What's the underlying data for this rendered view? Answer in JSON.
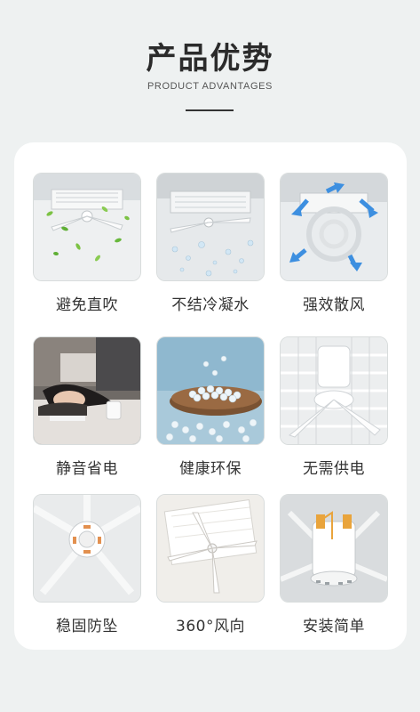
{
  "header": {
    "title": "产品优势",
    "subtitle": "PRODUCT ADVANTAGES"
  },
  "features": [
    {
      "label": "避免直吹",
      "icon": "ceiling-fan-leaves-photo"
    },
    {
      "label": "不结冷凝水",
      "icon": "ceiling-fan-water-drops-photo"
    },
    {
      "label": "强效散风",
      "icon": "airflow-arrows-photo"
    },
    {
      "label": "静音省电",
      "icon": "sleeping-person-photo"
    },
    {
      "label": "健康环保",
      "icon": "plastic-granules-photo"
    },
    {
      "label": "无需供电",
      "icon": "fan-hub-grille-photo"
    },
    {
      "label": "稳固防坠",
      "icon": "fan-mount-base-photo"
    },
    {
      "label": "360°风向",
      "icon": "rotating-blades-photo"
    },
    {
      "label": "安装简单",
      "icon": "fan-hub-closeup-photo"
    }
  ]
}
